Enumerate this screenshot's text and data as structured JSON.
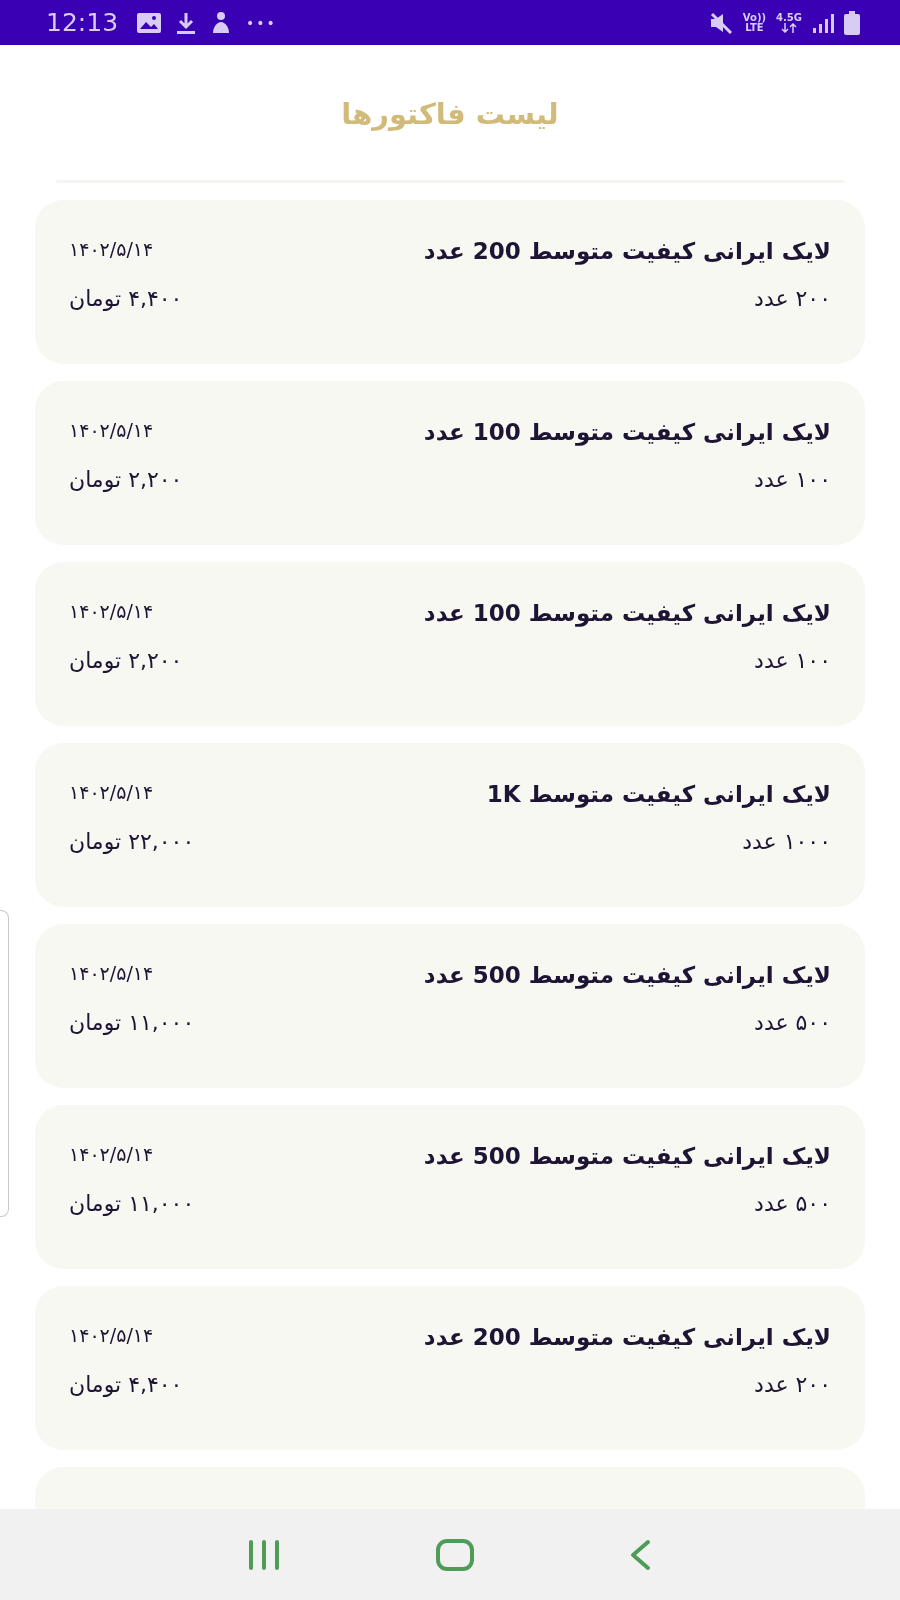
{
  "status_bar": {
    "time": "12:13",
    "more": "•••",
    "volte": "Vo))",
    "lte": "LTE",
    "network": "4.5G"
  },
  "header": {
    "title": "لیست فاکتورها"
  },
  "invoices": [
    {
      "title": "لایک ایرانی کیفیت متوسط 200 عدد",
      "date": "۱۴۰۲/۵/۱۴",
      "quantity": "۲۰۰ عدد",
      "price": "۴,۴۰۰ تومان"
    },
    {
      "title": "لایک ایرانی کیفیت متوسط 100 عدد",
      "date": "۱۴۰۲/۵/۱۴",
      "quantity": "۱۰۰ عدد",
      "price": "۲,۲۰۰ تومان"
    },
    {
      "title": "لایک ایرانی کیفیت متوسط 100 عدد",
      "date": "۱۴۰۲/۵/۱۴",
      "quantity": "۱۰۰ عدد",
      "price": "۲,۲۰۰ تومان"
    },
    {
      "title": "لایک ایرانی کیفیت متوسط 1K",
      "date": "۱۴۰۲/۵/۱۴",
      "quantity": "۱۰۰۰ عدد",
      "price": "۲۲,۰۰۰ تومان"
    },
    {
      "title": "لایک ایرانی کیفیت متوسط 500 عدد",
      "date": "۱۴۰۲/۵/۱۴",
      "quantity": "۵۰۰ عدد",
      "price": "۱۱,۰۰۰ تومان"
    },
    {
      "title": "لایک ایرانی کیفیت متوسط 500 عدد",
      "date": "۱۴۰۲/۵/۱۴",
      "quantity": "۵۰۰ عدد",
      "price": "۱۱,۰۰۰ تومان"
    },
    {
      "title": "لایک ایرانی کیفیت متوسط 200 عدد",
      "date": "۱۴۰۲/۵/۱۴",
      "quantity": "۲۰۰ عدد",
      "price": "۴,۴۰۰ تومان"
    }
  ]
}
